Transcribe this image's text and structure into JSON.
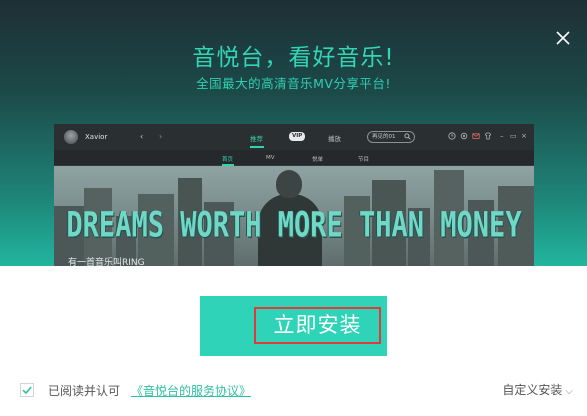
{
  "header": {
    "headline": "音悦台，看好音乐!",
    "subline": "全国最大的高清音乐MV分享平台!"
  },
  "preview": {
    "user_name": "Xavior",
    "tabs": [
      "推荐",
      "VIP",
      "播放"
    ],
    "active_tab": "推荐",
    "search_placeholder": "再见的01",
    "sub_tabs": [
      "首页",
      "MV",
      "悦单",
      "节目"
    ],
    "banner_text": "DREAMS WORTH MORE THAN MONEY",
    "banner_caption": "有一首音乐叫RING"
  },
  "install": {
    "label": "立即安装"
  },
  "agreement": {
    "text": "已阅读并认可",
    "link": "《音悦台的服务协议》",
    "checked": true
  },
  "custom_install": {
    "label": "自定义安装"
  },
  "colors": {
    "accent": "#2fd3b8",
    "highlight_border": "#e03a3a"
  }
}
